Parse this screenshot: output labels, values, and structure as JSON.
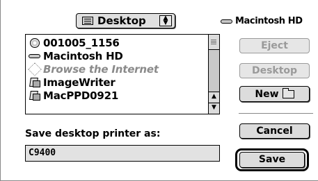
{
  "location_popup": {
    "label": "Desktop",
    "icon": "desktop-icon"
  },
  "volume": {
    "label": "Macintosh HD",
    "icon": "hard-drive-icon"
  },
  "file_list": {
    "items": [
      {
        "label": "001005_1156",
        "icon": "cd-icon",
        "enabled": true
      },
      {
        "label": "Macintosh HD",
        "icon": "hard-drive-icon",
        "enabled": true
      },
      {
        "label": "Browse the Internet",
        "icon": "internet-icon",
        "enabled": false
      },
      {
        "label": "ImageWriter",
        "icon": "printer-icon",
        "enabled": true
      },
      {
        "label": "MacPPD0921",
        "icon": "printer-icon",
        "enabled": true
      }
    ]
  },
  "buttons": {
    "eject": {
      "label": "Eject",
      "enabled": false
    },
    "desktop": {
      "label": "Desktop",
      "enabled": false
    },
    "new": {
      "label": "New",
      "enabled": true
    },
    "cancel": {
      "label": "Cancel",
      "enabled": true
    },
    "save": {
      "label": "Save",
      "enabled": true,
      "default": true
    }
  },
  "save_prompt": "Save desktop printer as:",
  "name_field": {
    "value": "C9400"
  },
  "colors": {
    "disabled_text": "#9a9a9a",
    "button_face": "#dcdcdc"
  }
}
